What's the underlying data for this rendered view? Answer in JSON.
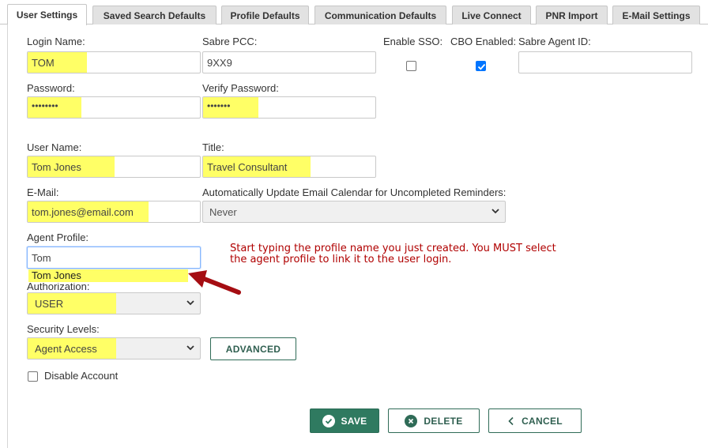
{
  "tabs": [
    {
      "label": "User Settings"
    },
    {
      "label": "Saved Search Defaults"
    },
    {
      "label": "Profile Defaults"
    },
    {
      "label": "Communication Defaults"
    },
    {
      "label": "Live Connect"
    },
    {
      "label": "PNR Import"
    },
    {
      "label": "E-Mail Settings"
    }
  ],
  "form": {
    "login_name": {
      "label": "Login Name:",
      "value": "TOM"
    },
    "sabre_pcc": {
      "label": "Sabre PCC:",
      "value": "9XX9"
    },
    "enable_sso": {
      "label": "Enable SSO:",
      "checked": false
    },
    "cbo_enabled": {
      "label": "CBO Enabled:",
      "checked": true
    },
    "sabre_agent_id": {
      "label": "Sabre Agent ID:",
      "value": ""
    },
    "password": {
      "label": "Password:",
      "value": "••••••••"
    },
    "verify_password": {
      "label": "Verify Password:",
      "value": "•••••••"
    },
    "user_name": {
      "label": "User Name:",
      "value": "Tom Jones"
    },
    "title": {
      "label": "Title:",
      "value": "Travel Consultant"
    },
    "email": {
      "label": "E-Mail:",
      "value": "tom.jones@email.com"
    },
    "auto_update": {
      "label": "Automatically Update Email Calendar for Uncompleted Reminders:",
      "value": "Never"
    },
    "agent_profile": {
      "label": "Agent Profile:",
      "value": "Tom",
      "suggestion": "Tom Jones"
    },
    "authorization": {
      "label": "Authorization:",
      "value": "USER"
    },
    "security_levels": {
      "label": "Security Levels:",
      "value": "Agent Access"
    },
    "advanced_label": "ADVANCED",
    "disable_account": {
      "label": "Disable Account",
      "checked": false
    }
  },
  "annotation": {
    "line1": "Start typing the profile name you just created.  You MUST select",
    "line2": "the agent profile to link it to the user login."
  },
  "actions": {
    "save": "SAVE",
    "delete": "DELETE",
    "cancel": "CANCEL"
  },
  "colors": {
    "highlight": "#ffff66",
    "accent": "#2f7a60",
    "annotation": "#b00000",
    "arrow": "#a50d12"
  }
}
